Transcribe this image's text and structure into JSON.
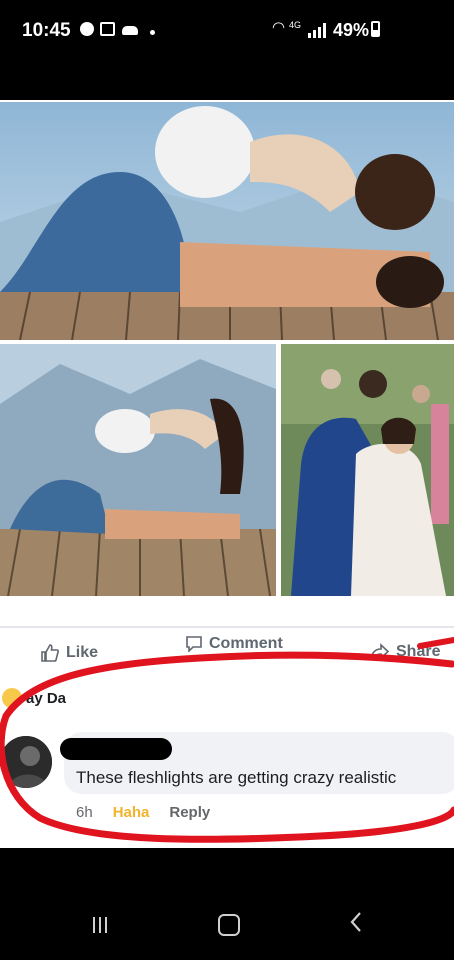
{
  "status_bar": {
    "time": "10:45",
    "network": "4G",
    "battery": "49%"
  },
  "post": {
    "actions": {
      "like": "Like",
      "comment": "Comment",
      "share": "Share"
    },
    "reactor_name": "ay Da",
    "comment": {
      "text": "These fleshlights are getting crazy realistic",
      "time": "6h",
      "haha": "Haha",
      "reply": "Reply"
    }
  },
  "colors": {
    "annotation": "#e0141e",
    "haha": "#f2b32d"
  }
}
